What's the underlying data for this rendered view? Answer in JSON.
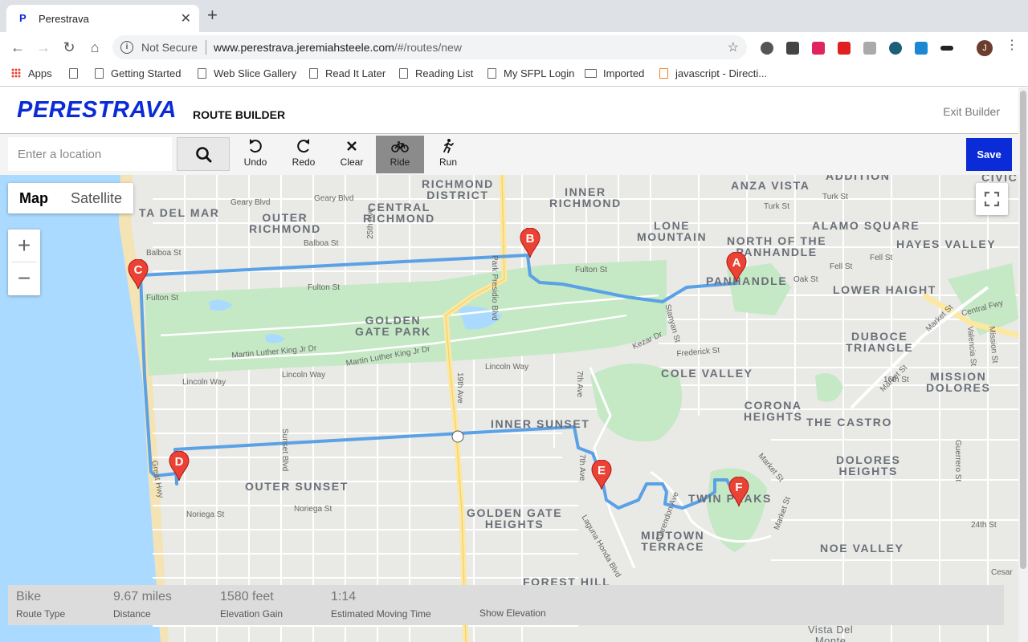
{
  "browser": {
    "tab_title": "Perestrava",
    "tab_favicon": "P",
    "security_label": "Not Secure",
    "url_host": "www.perestrava.jeremiahsteele.com",
    "url_path": "/#/routes/new",
    "profile_initial": "J",
    "bookmarks": [
      "Apps",
      "Getting Started",
      "Web Slice Gallery",
      "Read It Later",
      "Reading List",
      "My SFPL Login",
      "Imported",
      "javascript - Directi..."
    ]
  },
  "header": {
    "logo": "PERESTRAVA",
    "title": "ROUTE BUILDER",
    "exit_label": "Exit Builder"
  },
  "toolbar": {
    "location_placeholder": "Enter a location",
    "undo_label": "Undo",
    "redo_label": "Redo",
    "clear_label": "Clear",
    "ride_label": "Ride",
    "run_label": "Run",
    "active_mode": "Ride",
    "save_label": "Save"
  },
  "map": {
    "type_map": "Map",
    "type_satellite": "Satellite",
    "selected_type": "Map",
    "markers": [
      "A",
      "B",
      "C",
      "D",
      "E",
      "F"
    ],
    "route_color": "#5aa1e6",
    "marker_color": "#ea4335",
    "neighborhoods": {
      "richmond_district": "RICHMOND\nDISTRICT",
      "inner_richmond": "INNER\nRICHMOND",
      "anza_vista": "ANZA VISTA",
      "outer_richmond": "OUTER\nRICHMOND",
      "central_richmond": "CENTRAL\nRICHMOND",
      "lone_mountain": "LONE\nMOUNTAIN",
      "alamo_square": "ALAMO SQUARE",
      "north_panhandle": "NORTH OF THE\nPANHANDLE",
      "hayes_valley": "HAYES VALLEY",
      "panhandle": "PANHANDLE",
      "lower_haight": "LOWER HAIGHT",
      "golden_gate_park": "GOLDEN\nGATE PARK",
      "duboce_triangle": "DUBOCE\nTRIANGLE",
      "cole_valley": "COLE VALLEY",
      "mission_dolores": "MISSION\nDOLORES",
      "corona_heights": "CORONA\nHEIGHTS",
      "the_castro": "THE CASTRO",
      "inner_sunset": "INNER SUNSET",
      "dolores_heights": "DOLORES\nHEIGHTS",
      "outer_sunset": "OUTER SUNSET",
      "twin_peaks": "TWIN PEAKS",
      "golden_gate_heights": "GOLDEN GATE\nHEIGHTS",
      "midtown_terrace": "MIDTOWN\nTERRACE",
      "noe_valley": "NOE VALLEY",
      "forest_hill": "FOREST HILL",
      "addition": "ADDITION",
      "civic": "CIVIC",
      "vista_del_monte": "Vista Del\nMonte",
      "fa_del_mar": "TA DEL MAR"
    },
    "streets": {
      "geary": "Geary Blvd",
      "balboa_w": "Balboa St",
      "balboa_e": "Balboa St",
      "fulton_w": "Fulton St",
      "fulton_m": "Fulton St",
      "fulton_e": "Fulton St",
      "fell": "Fell St",
      "oak": "Oak St",
      "turk": "Turk St",
      "turk2": "Turk St",
      "ave25": "25th Ave",
      "park_presidio": "Park Presidio Blvd",
      "mlk1": "Martin Luther King Jr Dr",
      "mlk2": "Martin Luther King Jr Dr",
      "kezar": "Kezar Dr",
      "stanyan": "Stanyan St",
      "frederick": "Frederick St",
      "lincoln_w": "Lincoln Way",
      "lincoln_e": "Lincoln Way",
      "ave19": "19th Ave",
      "ave7": "7th Ave",
      "ave7b": "7th Ave",
      "sunset": "Sunset Blvd",
      "noriega_w": "Noriega St",
      "noriega_e": "Noriega St",
      "great_hwy": "Great Hwy",
      "laguna_honda": "Laguna Honda Blvd",
      "clarendon": "Clarendon Ave",
      "market1": "Market St",
      "market2": "Market St",
      "st16": "16th St",
      "central_fwy": "Central Fwy",
      "valencia": "Valencia St",
      "mission": "Mission St",
      "guerrero": "Guerrero St",
      "st24": "24th St",
      "cesar": "Cesar"
    }
  },
  "stats": {
    "route_type_value": "Bike",
    "route_type_label": "Route Type",
    "distance_value": "9.67 miles",
    "distance_label": "Distance",
    "elevation_value": "1580 feet",
    "elevation_label": "Elevation Gain",
    "time_value": "1:14",
    "time_label": "Estimated Moving Time",
    "show_elevation": "Show Elevation"
  }
}
